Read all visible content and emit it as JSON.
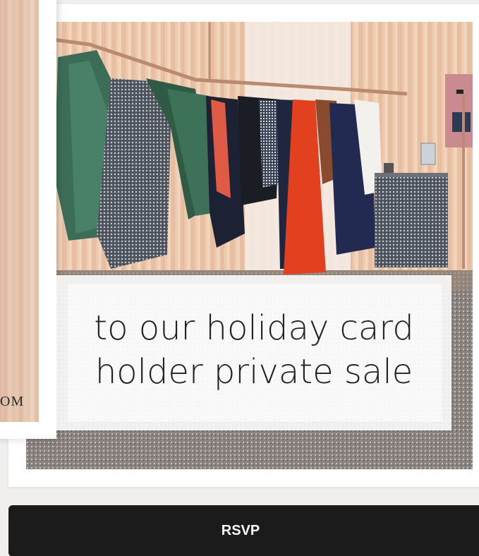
{
  "card": {
    "headline_line1": "to our holiday card",
    "headline_line2": "holder private sale",
    "photo_description_icon": "boutique-photo"
  },
  "left_card": {
    "partial_text": "OM"
  },
  "actions": {
    "rsvp_label": "RSVP"
  },
  "colors": {
    "button_bg": "#1b1b1b",
    "button_text": "#ffffff",
    "overlay_bg": "#ffffff",
    "text": "#222222"
  }
}
